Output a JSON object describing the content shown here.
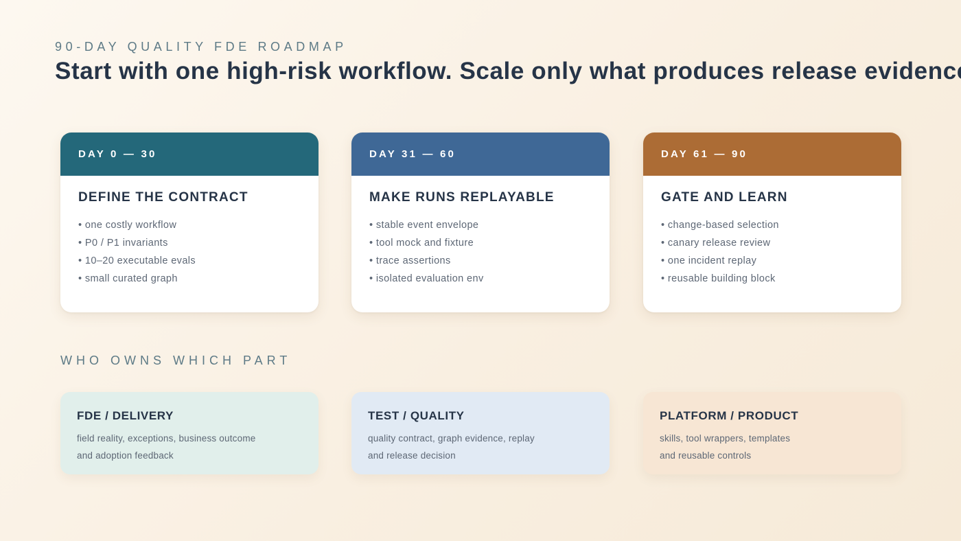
{
  "header": {
    "eyebrow": "90-DAY QUALITY FDE ROADMAP",
    "headline": "Start with one high-risk workflow. Scale only what produces release evidence."
  },
  "phases": [
    {
      "day_range": "DAY 0 — 30",
      "title": "DEFINE THE CONTRACT",
      "items": [
        "• one costly workflow",
        "• P0 / P1 invariants",
        "• 10–20 executable evals",
        "• small curated graph"
      ],
      "color": "#24687a"
    },
    {
      "day_range": "DAY 31 — 60",
      "title": "MAKE RUNS REPLAYABLE",
      "items": [
        "• stable event envelope",
        "• tool mock and fixture",
        "• trace assertions",
        "• isolated evaluation env"
      ],
      "color": "#3f6896"
    },
    {
      "day_range": "DAY 61 — 90",
      "title": "GATE AND LEARN",
      "items": [
        "• change-based selection",
        "• canary release review",
        "• one incident replay",
        "• reusable building block"
      ],
      "color": "#ac6c35"
    }
  ],
  "owners": {
    "section_label": "WHO OWNS WHICH PART",
    "cards": [
      {
        "title": "FDE / DELIVERY",
        "line1": "field reality, exceptions, business outcome",
        "line2": "and adoption feedback",
        "color": "#e1efeb"
      },
      {
        "title": "TEST / QUALITY",
        "line1": "quality contract, graph evidence, replay",
        "line2": "and release decision",
        "color": "#e1eaf4"
      },
      {
        "title": "PLATFORM / PRODUCT",
        "line1": "skills, tool wrappers, templates",
        "line2": "and reusable controls",
        "color": "#f7e6d4"
      }
    ]
  }
}
